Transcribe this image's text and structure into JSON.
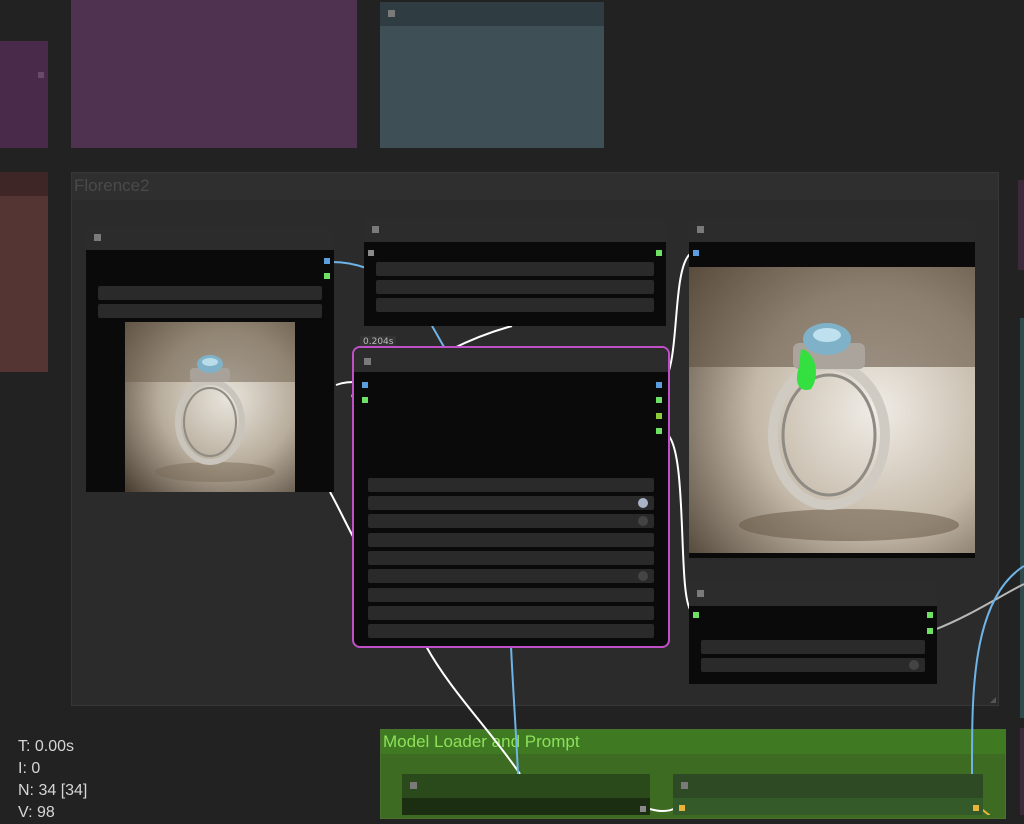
{
  "groups": {
    "florence2": {
      "title": "Florence2"
    },
    "model_loader": {
      "title": "Model Loader and Prompt"
    }
  },
  "selected_node": {
    "exec_time": "0.204s"
  },
  "stats": {
    "time": "T: 0.00s",
    "iterations": "I: 0",
    "nodes": "N: 34 [34]",
    "vertices": "V: 98"
  },
  "colors": {
    "canvas": "#222222",
    "group_florence": "#2b2b2b",
    "group_model_loader": "#3d6b22",
    "group_title_green": "#8ee05b",
    "selected_outline": "#c050c8",
    "link_image": "#6fb4e8",
    "link_white": "#ffffff",
    "slot_image": "#5b9ee0",
    "slot_mask": "#6ee066",
    "slot_model": "#e8b43c"
  },
  "icons": {
    "node_collapse": "collapse-square-icon",
    "toggle": "toggle-dot-icon"
  }
}
